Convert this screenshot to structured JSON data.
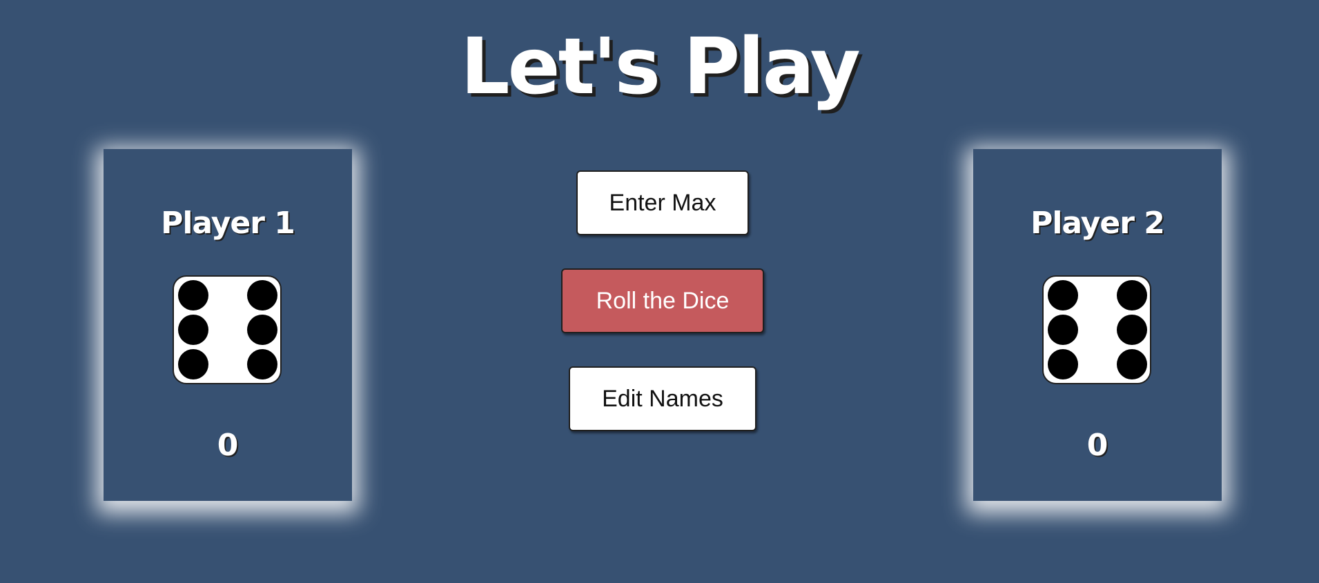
{
  "title": "Let's Play",
  "players": [
    {
      "name": "Player 1",
      "score": "0",
      "die_value": 6,
      "die_icon": "dice-six-icon"
    },
    {
      "name": "Player 2",
      "score": "0",
      "die_value": 6,
      "die_icon": "dice-six-icon"
    }
  ],
  "buttons": {
    "enter_max": "Enter Max",
    "roll_dice": "Roll the Dice",
    "edit_names": "Edit Names"
  },
  "colors": {
    "background": "#375172",
    "roll_button": "#c55a5d",
    "text": "#ffffff"
  }
}
